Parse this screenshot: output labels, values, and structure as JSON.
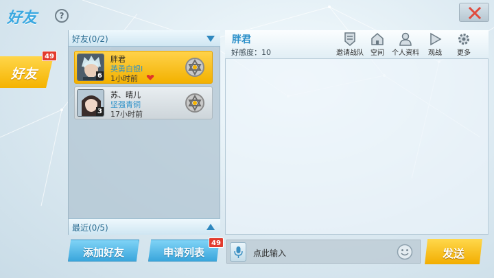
{
  "header": {
    "title": "好友",
    "help_symbol": "?"
  },
  "side_tab": {
    "label": "好友",
    "badge": "49"
  },
  "friend_list": {
    "header": "好友(0/2)",
    "recent_header": "最近(0/5)",
    "friends": [
      {
        "name": "胖君",
        "rank": "英勇白银I",
        "time": "1小时前",
        "level": "6",
        "selected": true
      },
      {
        "name": "苏、晴儿",
        "rank": "坚强青铜",
        "time": "17小时前",
        "level": "3",
        "selected": false
      }
    ]
  },
  "buttons": {
    "add_friend": "添加好友",
    "request_list": "申请列表",
    "request_badge": "49"
  },
  "chat": {
    "name": "胖君",
    "favor": "好感度：10",
    "tools": [
      {
        "label": "邀请战队",
        "icon": "team-invite-icon"
      },
      {
        "label": "空间",
        "icon": "home-icon"
      },
      {
        "label": "个人资料",
        "icon": "profile-icon"
      },
      {
        "label": "观战",
        "icon": "play-icon"
      },
      {
        "label": "更多",
        "icon": "gear-icon"
      }
    ],
    "input_placeholder": "点此输入",
    "send": "发送"
  },
  "colors": {
    "accent_yellow": "#f5b300",
    "accent_blue": "#3aa6dc",
    "badge_red": "#e23b2e"
  }
}
